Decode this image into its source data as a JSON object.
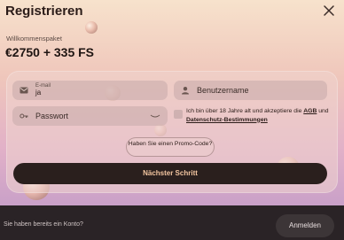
{
  "header": {
    "title": "Registrieren"
  },
  "welcome": {
    "label": "Willkommenspaket",
    "bonus": "€2750 + 335 FS"
  },
  "form": {
    "email": {
      "label": "E-mail",
      "value": "ja"
    },
    "username": {
      "placeholder": "Benutzername"
    },
    "password": {
      "placeholder": "Passwort"
    },
    "terms": {
      "text_before": "Ich bin über 18 Jahre alt und akzeptiere die ",
      "agb_link": "AGB",
      "text_mid": " und ",
      "privacy_link": "Datenschutz-Bestimmungen"
    },
    "promo_label": "Haben Sie einen Promo-Code?",
    "next_button": "Nächster Schritt"
  },
  "footer": {
    "question": "Sie haben bereits ein Konto?",
    "login_button": "Anmelden"
  },
  "icons": [
    "close-icon",
    "mail-icon",
    "user-icon",
    "key-icon",
    "eye-closed-icon"
  ],
  "colors": {
    "primary_button_bg": "#2a1f1d",
    "primary_button_text": "#f3c5a0",
    "footer_bg": "#2a2326"
  }
}
